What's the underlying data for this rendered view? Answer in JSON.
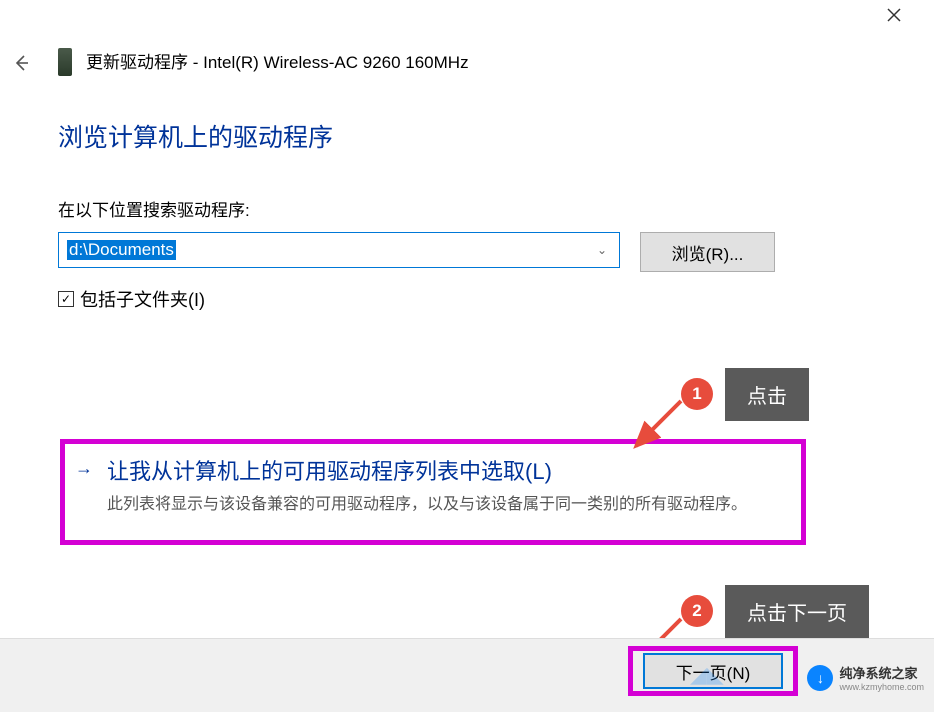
{
  "window": {
    "title_prefix": "更新驱动程序 - ",
    "device_name": "Intel(R) Wireless-AC 9260 160MHz"
  },
  "main": {
    "heading": "浏览计算机上的驱动程序",
    "search_label": "在以下位置搜索驱动程序:",
    "path_value": "d:\\Documents",
    "browse_button": "浏览(R)...",
    "include_subfolders": "包括子文件夹(I)",
    "option": {
      "title": "让我从计算机上的可用驱动程序列表中选取(L)",
      "description": "此列表将显示与该设备兼容的可用驱动程序，以及与该设备属于同一类别的所有驱动程序。"
    }
  },
  "footer": {
    "next_button": "下一页(N)"
  },
  "annotations": {
    "step1_badge": "1",
    "step1_label": "点击",
    "step2_badge": "2",
    "step2_label": "点击下一页"
  },
  "watermark": {
    "brand": "纯净系统之家",
    "url": "www.kzmyhome.com"
  }
}
